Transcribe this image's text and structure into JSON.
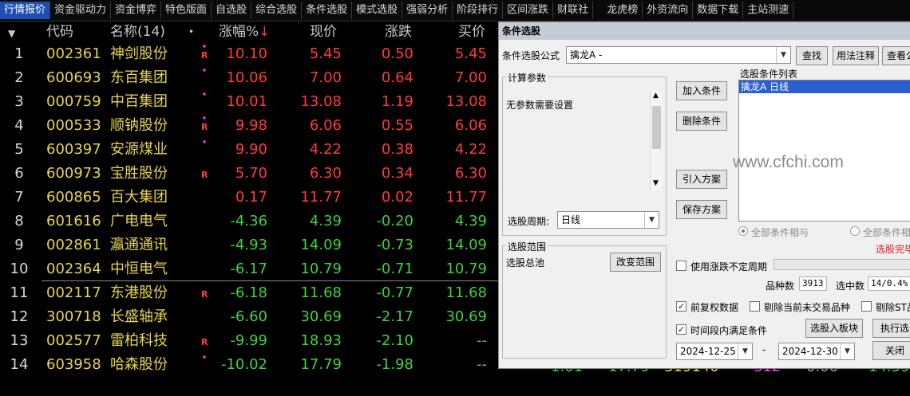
{
  "menu": [
    "行情报价",
    "资金驱动力",
    "资金博弈",
    "特色版面",
    "自选股",
    "综合选股",
    "条件选股",
    "模式选股",
    "强弱分析",
    "阶段排行",
    "区间涨跌",
    "财联社",
    "龙虎榜",
    "外资流向",
    "数据下载",
    "主站测速"
  ],
  "table": {
    "headers": {
      "code": "代码",
      "name": "名称(14)",
      "dot": "•",
      "pct": "涨幅%",
      "sort_icon": "↓",
      "price": "现价",
      "change": "涨跌",
      "buy": "买价"
    },
    "rows": [
      {
        "idx": "1",
        "code": "002361",
        "name": "神剑股份",
        "mark": "R",
        "dot": true,
        "pct": "10.10",
        "price": "5.45",
        "change": "0.50",
        "buy": "5.45",
        "color": "red"
      },
      {
        "idx": "2",
        "code": "600693",
        "name": "东百集团",
        "mark": "",
        "dot": true,
        "pct": "10.06",
        "price": "7.00",
        "change": "0.64",
        "buy": "7.00",
        "color": "red"
      },
      {
        "idx": "3",
        "code": "000759",
        "name": "中百集团",
        "mark": "",
        "dot": true,
        "pct": "10.01",
        "price": "13.08",
        "change": "1.19",
        "buy": "13.08",
        "color": "red"
      },
      {
        "idx": "4",
        "code": "000533",
        "name": "顺钠股份",
        "mark": "R",
        "dot": true,
        "pct": "9.98",
        "price": "6.06",
        "change": "0.55",
        "buy": "6.06",
        "color": "red"
      },
      {
        "idx": "5",
        "code": "600397",
        "name": "安源煤业",
        "mark": "",
        "dot": true,
        "pct": "9.90",
        "price": "4.22",
        "change": "0.38",
        "buy": "4.22",
        "color": "red"
      },
      {
        "idx": "6",
        "code": "600973",
        "name": "宝胜股份",
        "mark": "R",
        "dot": false,
        "pct": "5.70",
        "price": "6.30",
        "change": "0.34",
        "buy": "6.30",
        "color": "red"
      },
      {
        "idx": "7",
        "code": "600865",
        "name": "百大集团",
        "mark": "",
        "dot": false,
        "pct": "0.17",
        "price": "11.77",
        "change": "0.02",
        "buy": "11.77",
        "color": "red"
      },
      {
        "idx": "8",
        "code": "601616",
        "name": "广电电气",
        "mark": "",
        "dot": false,
        "pct": "-4.36",
        "price": "4.39",
        "change": "-0.20",
        "buy": "4.39",
        "color": "green"
      },
      {
        "idx": "9",
        "code": "002861",
        "name": "瀛通通讯",
        "mark": "",
        "dot": false,
        "pct": "-4.93",
        "price": "14.09",
        "change": "-0.73",
        "buy": "14.09",
        "color": "green"
      },
      {
        "idx": "10",
        "code": "002364",
        "name": "中恒电气",
        "mark": "",
        "dot": false,
        "pct": "-6.17",
        "price": "10.79",
        "change": "-0.71",
        "buy": "10.79",
        "color": "green"
      },
      {
        "idx": "11",
        "code": "002117",
        "name": "东港股份",
        "mark": "R",
        "dot": false,
        "pct": "-6.18",
        "price": "11.68",
        "change": "-0.77",
        "buy": "11.68",
        "color": "green"
      },
      {
        "idx": "12",
        "code": "300718",
        "name": "长盛轴承",
        "mark": "",
        "dot": false,
        "pct": "-6.60",
        "price": "30.69",
        "change": "-2.17",
        "buy": "30.69",
        "color": "green"
      },
      {
        "idx": "13",
        "code": "002577",
        "name": "雷柏科技",
        "mark": "R",
        "dot": false,
        "pct": "-9.99",
        "price": "18.93",
        "change": "-2.10",
        "buy": "--",
        "color": "green"
      },
      {
        "idx": "14",
        "code": "603958",
        "name": "哈森股份",
        "mark": "",
        "dot": true,
        "pct": "-10.02",
        "price": "17.79",
        "change": "-1.98",
        "buy": "--",
        "color": "green"
      }
    ]
  },
  "background_fragments": [
    "1.01",
    "17.79",
    "319140",
    "312",
    "0.00",
    "14.59"
  ],
  "dialog": {
    "title": "条件选股",
    "formula_label": "条件选股公式",
    "formula_value": "擒龙A  -",
    "find_btn": "查找",
    "usage_btn": "用法注释",
    "view_btn": "查看公",
    "calc_params_title": "计算参数",
    "no_params": "无参数需要设置",
    "period_label": "选股周期:",
    "period_value": "日线",
    "add_cond_btn": "加入条件",
    "delete_cond_btn": "删除条件",
    "import_plan_btn": "引入方案",
    "save_plan_btn": "保存方案",
    "cond_list_title": "选股条件列表",
    "cond_list_items": [
      "擒龙A  日线"
    ],
    "all_and": "全部条件相与",
    "all_or": "全部条件相",
    "done_text": "选股完毕",
    "range_title": "选股范围",
    "range_value": "选股总池",
    "change_range_btn": "改变范围",
    "indeterminate_period": "使用涨跌不定周期",
    "count_label": "品种数",
    "count_value": "3913",
    "selected_label": "选中数",
    "selected_value": "14/0.4%",
    "pre_adjust": "前复权数据",
    "exclude_untraded": "剔除当前未交易品种",
    "exclude_st": "剔除ST品",
    "time_condition": "时间段内满足条件",
    "to_block_btn": "选股入板块",
    "execute_btn": "执行选",
    "date_from": "2024-12-25",
    "date_sep": "-",
    "date_to": "2024-12-30",
    "close_btn": "关闭"
  },
  "watermark": "www.cfchi.com",
  "colors": {
    "up": "#ff3b3b",
    "down": "#3ed23e",
    "code": "#e8d44d",
    "active_tab": "#1d4fb0",
    "selection": "#2a5fd0"
  }
}
